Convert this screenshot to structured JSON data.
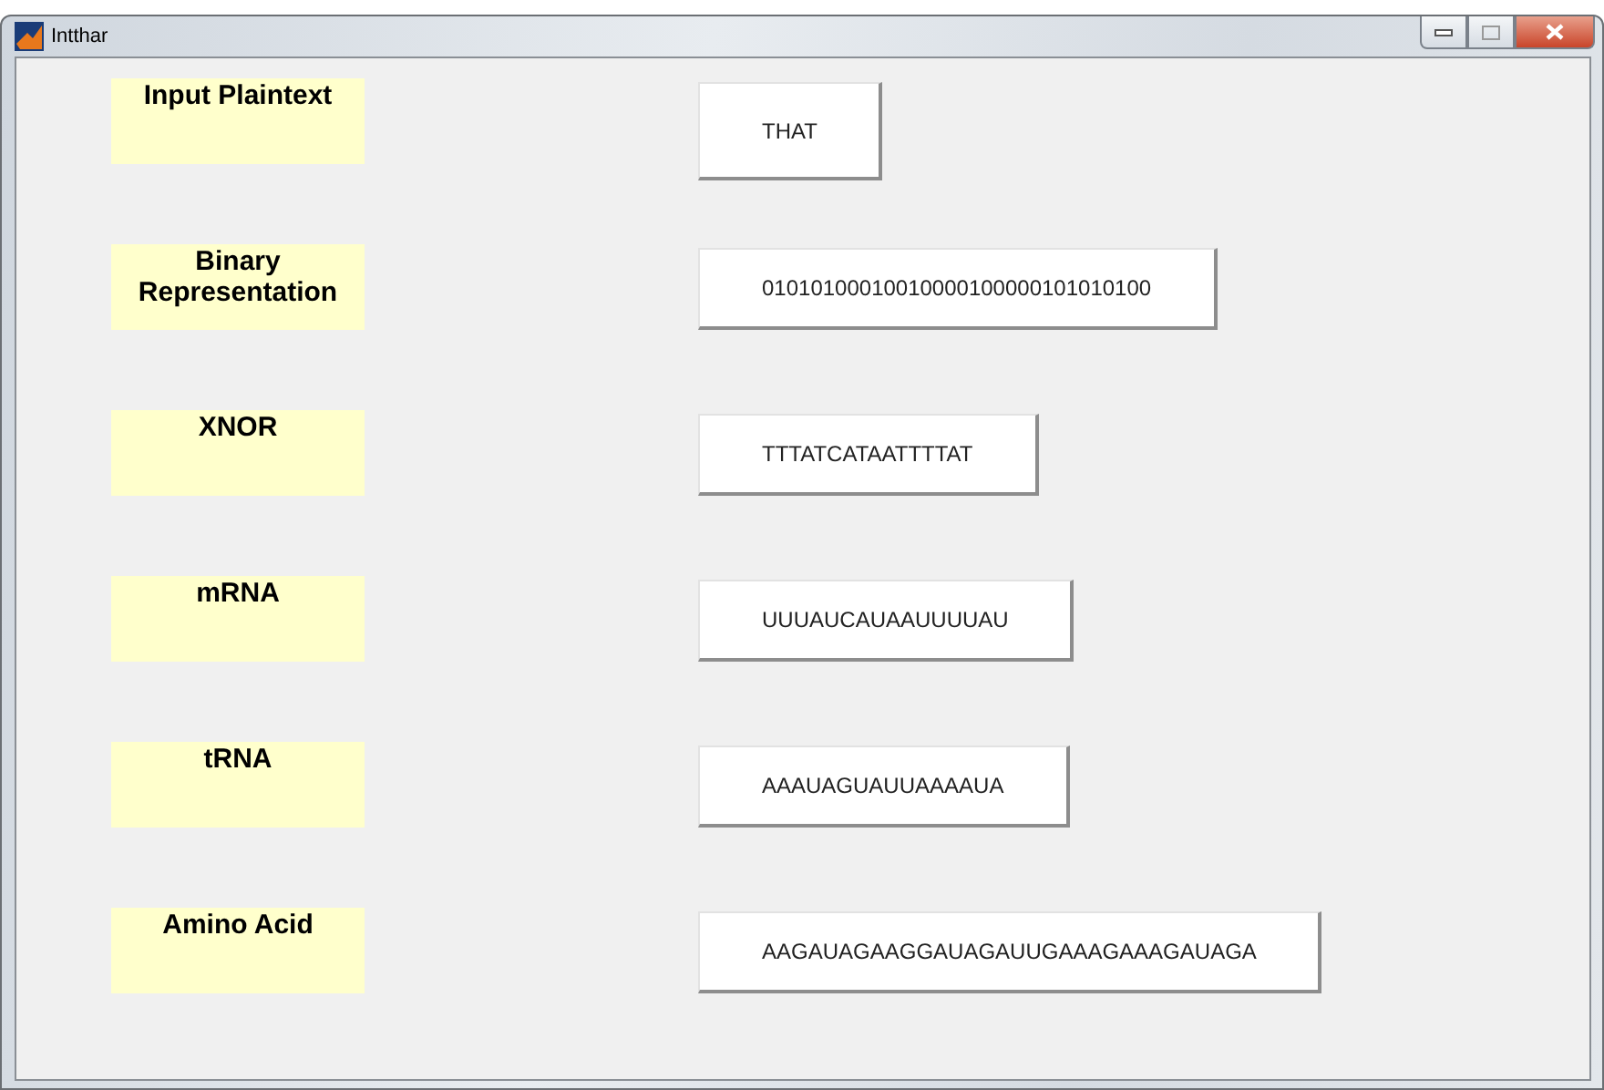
{
  "window": {
    "title": "Intthar"
  },
  "rows": [
    {
      "label": "Input Plaintext",
      "value": "THAT",
      "kind": "input"
    },
    {
      "label": "Binary Representation",
      "value": "01010100010010000100000101010100",
      "kind": "output"
    },
    {
      "label": "XNOR",
      "value": "TTTATCATAATTTTAT",
      "kind": "output"
    },
    {
      "label": "mRNA",
      "value": "UUUAUCAUAAUUUUAU",
      "kind": "output"
    },
    {
      "label": "tRNA",
      "value": "AAAUAGUAUUAAAAUA",
      "kind": "output"
    },
    {
      "label": "Amino Acid",
      "value": "AAGAUAGAAGGAUAGAUUGAAAGAAAGAUAGA",
      "kind": "output"
    }
  ]
}
